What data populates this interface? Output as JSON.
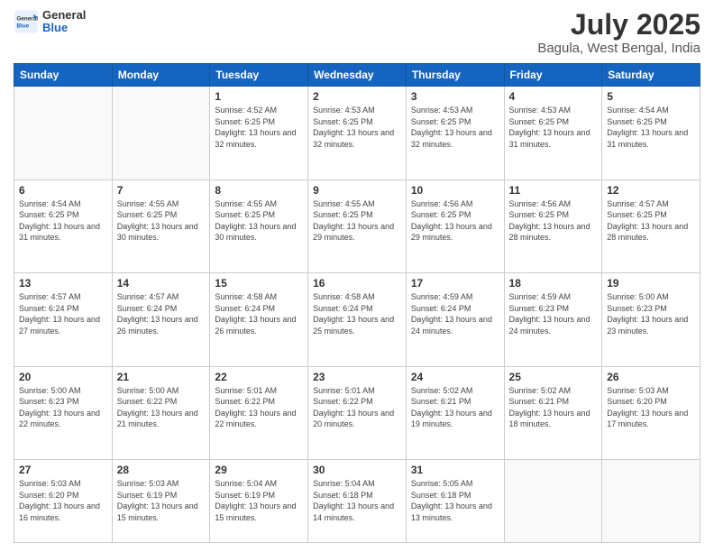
{
  "header": {
    "logo": {
      "general": "General",
      "blue": "Blue"
    },
    "title": "July 2025",
    "subtitle": "Bagula, West Bengal, India"
  },
  "weekdays": [
    "Sunday",
    "Monday",
    "Tuesday",
    "Wednesday",
    "Thursday",
    "Friday",
    "Saturday"
  ],
  "weeks": [
    [
      {
        "day": "",
        "info": ""
      },
      {
        "day": "",
        "info": ""
      },
      {
        "day": "1",
        "info": "Sunrise: 4:52 AM\nSunset: 6:25 PM\nDaylight: 13 hours and 32 minutes."
      },
      {
        "day": "2",
        "info": "Sunrise: 4:53 AM\nSunset: 6:25 PM\nDaylight: 13 hours and 32 minutes."
      },
      {
        "day": "3",
        "info": "Sunrise: 4:53 AM\nSunset: 6:25 PM\nDaylight: 13 hours and 32 minutes."
      },
      {
        "day": "4",
        "info": "Sunrise: 4:53 AM\nSunset: 6:25 PM\nDaylight: 13 hours and 31 minutes."
      },
      {
        "day": "5",
        "info": "Sunrise: 4:54 AM\nSunset: 6:25 PM\nDaylight: 13 hours and 31 minutes."
      }
    ],
    [
      {
        "day": "6",
        "info": "Sunrise: 4:54 AM\nSunset: 6:25 PM\nDaylight: 13 hours and 31 minutes."
      },
      {
        "day": "7",
        "info": "Sunrise: 4:55 AM\nSunset: 6:25 PM\nDaylight: 13 hours and 30 minutes."
      },
      {
        "day": "8",
        "info": "Sunrise: 4:55 AM\nSunset: 6:25 PM\nDaylight: 13 hours and 30 minutes."
      },
      {
        "day": "9",
        "info": "Sunrise: 4:55 AM\nSunset: 6:25 PM\nDaylight: 13 hours and 29 minutes."
      },
      {
        "day": "10",
        "info": "Sunrise: 4:56 AM\nSunset: 6:25 PM\nDaylight: 13 hours and 29 minutes."
      },
      {
        "day": "11",
        "info": "Sunrise: 4:56 AM\nSunset: 6:25 PM\nDaylight: 13 hours and 28 minutes."
      },
      {
        "day": "12",
        "info": "Sunrise: 4:57 AM\nSunset: 6:25 PM\nDaylight: 13 hours and 28 minutes."
      }
    ],
    [
      {
        "day": "13",
        "info": "Sunrise: 4:57 AM\nSunset: 6:24 PM\nDaylight: 13 hours and 27 minutes."
      },
      {
        "day": "14",
        "info": "Sunrise: 4:57 AM\nSunset: 6:24 PM\nDaylight: 13 hours and 26 minutes."
      },
      {
        "day": "15",
        "info": "Sunrise: 4:58 AM\nSunset: 6:24 PM\nDaylight: 13 hours and 26 minutes."
      },
      {
        "day": "16",
        "info": "Sunrise: 4:58 AM\nSunset: 6:24 PM\nDaylight: 13 hours and 25 minutes."
      },
      {
        "day": "17",
        "info": "Sunrise: 4:59 AM\nSunset: 6:24 PM\nDaylight: 13 hours and 24 minutes."
      },
      {
        "day": "18",
        "info": "Sunrise: 4:59 AM\nSunset: 6:23 PM\nDaylight: 13 hours and 24 minutes."
      },
      {
        "day": "19",
        "info": "Sunrise: 5:00 AM\nSunset: 6:23 PM\nDaylight: 13 hours and 23 minutes."
      }
    ],
    [
      {
        "day": "20",
        "info": "Sunrise: 5:00 AM\nSunset: 6:23 PM\nDaylight: 13 hours and 22 minutes."
      },
      {
        "day": "21",
        "info": "Sunrise: 5:00 AM\nSunset: 6:22 PM\nDaylight: 13 hours and 21 minutes."
      },
      {
        "day": "22",
        "info": "Sunrise: 5:01 AM\nSunset: 6:22 PM\nDaylight: 13 hours and 22 minutes."
      },
      {
        "day": "23",
        "info": "Sunrise: 5:01 AM\nSunset: 6:22 PM\nDaylight: 13 hours and 20 minutes."
      },
      {
        "day": "24",
        "info": "Sunrise: 5:02 AM\nSunset: 6:21 PM\nDaylight: 13 hours and 19 minutes."
      },
      {
        "day": "25",
        "info": "Sunrise: 5:02 AM\nSunset: 6:21 PM\nDaylight: 13 hours and 18 minutes."
      },
      {
        "day": "26",
        "info": "Sunrise: 5:03 AM\nSunset: 6:20 PM\nDaylight: 13 hours and 17 minutes."
      }
    ],
    [
      {
        "day": "27",
        "info": "Sunrise: 5:03 AM\nSunset: 6:20 PM\nDaylight: 13 hours and 16 minutes."
      },
      {
        "day": "28",
        "info": "Sunrise: 5:03 AM\nSunset: 6:19 PM\nDaylight: 13 hours and 15 minutes."
      },
      {
        "day": "29",
        "info": "Sunrise: 5:04 AM\nSunset: 6:19 PM\nDaylight: 13 hours and 15 minutes."
      },
      {
        "day": "30",
        "info": "Sunrise: 5:04 AM\nSunset: 6:18 PM\nDaylight: 13 hours and 14 minutes."
      },
      {
        "day": "31",
        "info": "Sunrise: 5:05 AM\nSunset: 6:18 PM\nDaylight: 13 hours and 13 minutes."
      },
      {
        "day": "",
        "info": ""
      },
      {
        "day": "",
        "info": ""
      }
    ]
  ]
}
